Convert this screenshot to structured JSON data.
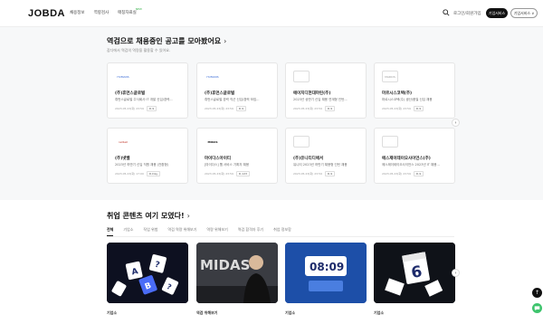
{
  "header": {
    "logo": "JOBDA",
    "nav": [
      "채용정보",
      "역량검사",
      "매칭자료실"
    ],
    "nav_badge": "NEW",
    "login": "로그인/회원가입",
    "btn_primary": "기업서비스",
    "btn_secondary": "기업서비스 ∨"
  },
  "section1": {
    "title": "역검으로 채용중인 공고를 모아봤어요",
    "subtitle": "잡다에서 역검의 역량을 활용할 수 있어요.",
    "cards": [
      {
        "company": "(주)휴먼스글로벌",
        "title": "휴먼스글로벌 주식회사 IT 개발 신입/경력...",
        "date": "2023.05.23(화) 23:59",
        "dday": "D-9",
        "logo_text": "HUMANS"
      },
      {
        "company": "(주)휴먼스글로벌",
        "title": "휴먼스글로벌 경력 직군 신입/경력 모집...",
        "date": "2023.05.23(화) 23:59",
        "dday": "D-9",
        "logo_text": "HUMANS"
      },
      {
        "company": "에이치디현대마린(주)",
        "title": "2023년 상반기 신입 채용 연계형 인턴...",
        "date": "2023.05.23(화) 23:59",
        "dday": "D-9",
        "logo_text": ""
      },
      {
        "company": "마르시스코텍(주)",
        "title": "마르시스코텍(주) 생산/품질 신입 채용",
        "date": "2023.05.23(화) 23:59",
        "dday": "D-9",
        "logo_text": "MARCIS"
      },
      {
        "company": "(주)넷밸",
        "title": "2023년 하반기 신입 직원 채용 (전환형)",
        "date": "2023.05.23(화) 17:00",
        "dday": "D-Day",
        "logo_text": "netbell"
      },
      {
        "company": "마이다스아이티",
        "title": "[마이다스] 웹 서비스 기획자 채용",
        "date": "2023.05.23(화) 23:59",
        "dday": "D-123",
        "logo_text": "MIDAS"
      },
      {
        "company": "(주)유니티디에서",
        "title": "유니티 2023년 하반기 채용형 인턴 채용",
        "date": "2023.05.23(화) 23:59",
        "dday": "D-9",
        "logo_text": ""
      },
      {
        "company": "에스제이테이오사이언스(주)",
        "title": "에스제이테이오사이언스 2023년 IT 채용...",
        "date": "2023.05.23(화) 23:59",
        "dday": "D-9",
        "logo_text": ""
      }
    ]
  },
  "section2": {
    "title": "취업 콘텐츠 여기 모였다!",
    "tabs": [
      "전체",
      "기업소",
      "직업 위험",
      "역검 역량 위해보기",
      "역량 위해보기",
      "역검 합격자 후기",
      "취업 정보함"
    ],
    "thumbs": [
      {
        "category": "기업소",
        "text": ""
      },
      {
        "category": "역검 위해보기",
        "text": "MIDAS"
      },
      {
        "category": "기업소",
        "text": "08:09"
      },
      {
        "category": "기업소",
        "text": "6"
      }
    ]
  },
  "colors": {
    "accent": "#38b24b",
    "dark": "#111111",
    "chat": "#3ec46d"
  }
}
